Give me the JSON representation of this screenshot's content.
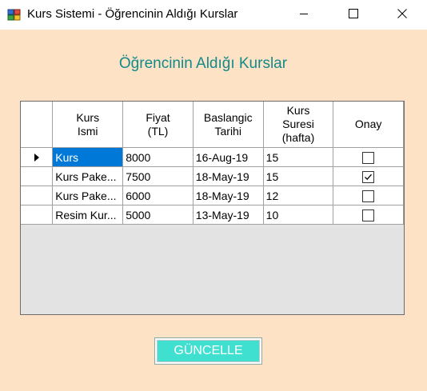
{
  "window": {
    "title": "Kurs Sistemi - Öğrencinin Aldığı Kurslar",
    "icons": {
      "app": "app-icon",
      "minimize": "minimize-icon",
      "maximize": "maximize-icon",
      "close": "close-icon"
    }
  },
  "main": {
    "heading": "Öğrencinin Aldığı Kurslar",
    "heading_color": "#128a8a",
    "background_color": "#fde2c6"
  },
  "grid": {
    "headers": {
      "kurs_ismi": [
        "Kurs",
        "Ismi"
      ],
      "fiyat": [
        "Fiyat",
        "(TL)"
      ],
      "baslangic": [
        "Baslangic",
        "Tarihi"
      ],
      "suresi": [
        "Kurs",
        "Suresi",
        "(hafta)"
      ],
      "onay": "Onay"
    },
    "current_row_indicator": "row-pointer-icon",
    "selection_color": "#0078d7",
    "rows": [
      {
        "name": "Kurs",
        "price": "8000",
        "start": "16-Aug-19",
        "weeks": "15",
        "approved": false
      },
      {
        "name": "Kurs Pake...",
        "price": "7500",
        "start": "18-May-19",
        "weeks": "15",
        "approved": true
      },
      {
        "name": "Kurs Pake...",
        "price": "6000",
        "start": "18-May-19",
        "weeks": "12",
        "approved": false
      },
      {
        "name": "Resim Kur...",
        "price": "5000",
        "start": "13-May-19",
        "weeks": "10",
        "approved": false
      }
    ]
  },
  "actions": {
    "update_label": "GÜNCELLE",
    "update_color": "#40e0d0"
  }
}
